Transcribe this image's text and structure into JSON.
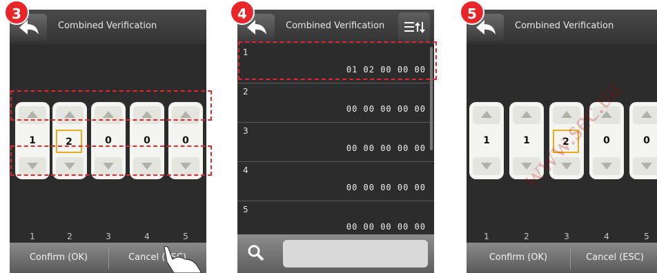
{
  "steps": [
    "3",
    "4",
    "5"
  ],
  "title": "Combined Verification",
  "panel3": {
    "values": [
      "1",
      "2",
      "0",
      "0",
      "0"
    ],
    "colnums": [
      "1",
      "2",
      "3",
      "4",
      "5"
    ],
    "confirm": "Confirm (OK)",
    "cancel": "Cancel (ESC)"
  },
  "panel4": {
    "rows": [
      {
        "num": "1",
        "code": "01 02 00 00 00"
      },
      {
        "num": "2",
        "code": "00 00 00 00 00"
      },
      {
        "num": "3",
        "code": "00 00 00 00 00"
      },
      {
        "num": "4",
        "code": "00 00 00 00 00"
      },
      {
        "num": "5",
        "code": "00 00 00 00 00"
      }
    ],
    "search_placeholder": ""
  },
  "panel5": {
    "values": [
      "1",
      "1",
      "2",
      "0",
      "0"
    ],
    "colnums": [
      "1",
      "2",
      "3",
      "4",
      "5"
    ],
    "confirm": "Confirm (OK)",
    "cancel": "Cancel (ESC)"
  },
  "watermark": "www.sec.ua",
  "colors": {
    "accent_red": "#e8262a",
    "focus_orange": "#f0a81c",
    "panel_bg": "#2c2c2c"
  },
  "icons": [
    "back-arrow-icon",
    "sort-menu-icon",
    "search-icon",
    "hand-pointer-icon"
  ]
}
